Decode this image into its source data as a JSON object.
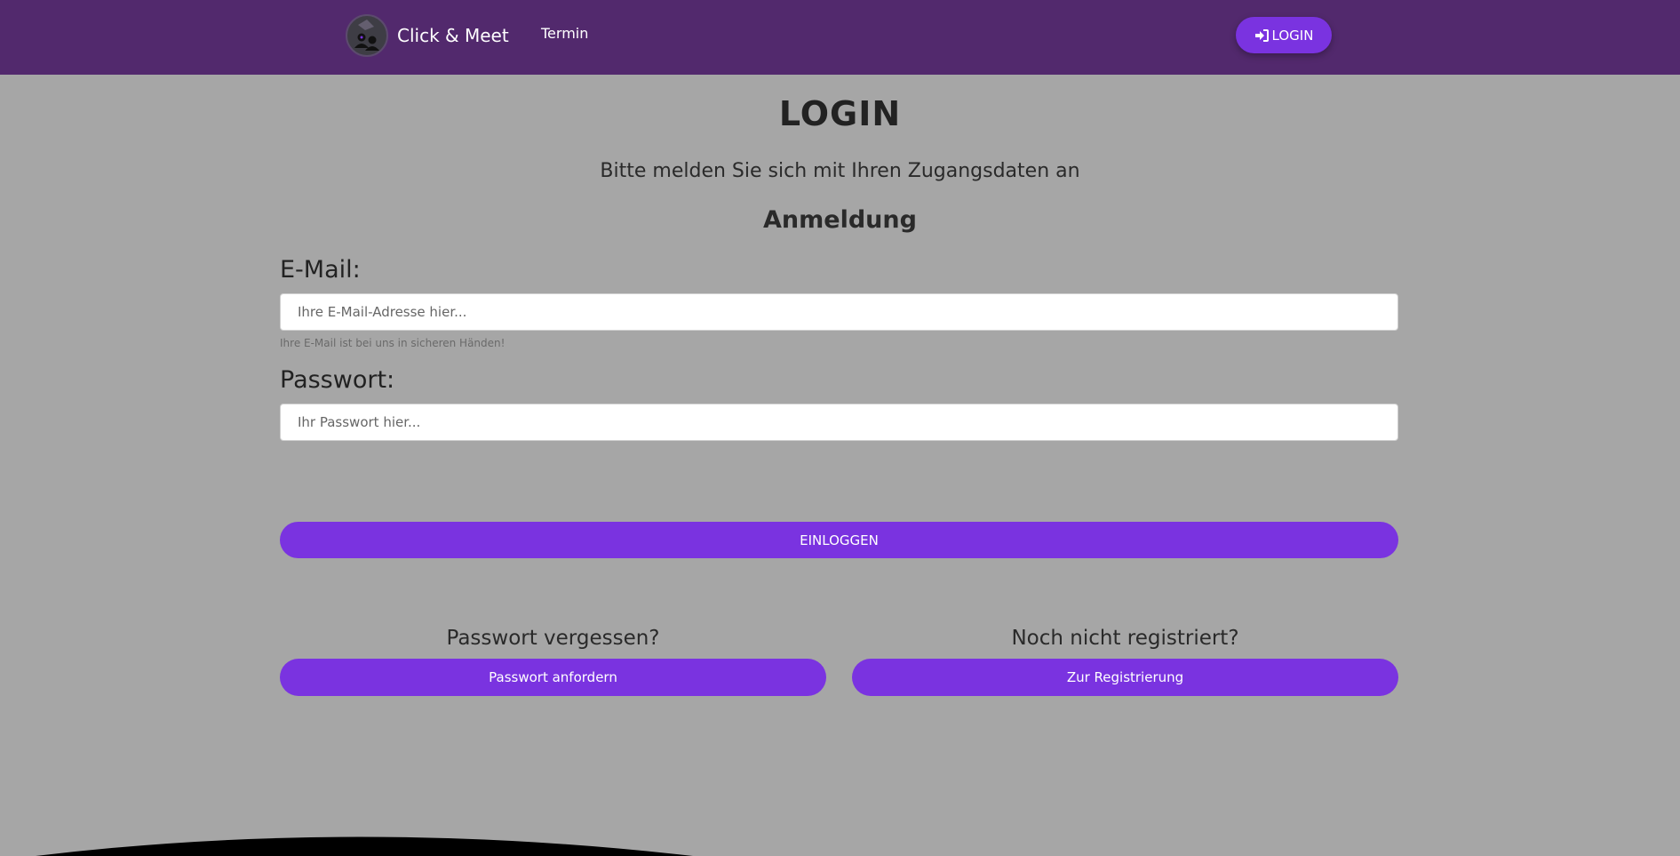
{
  "navbar": {
    "brand": "Click & Meet",
    "links": [
      {
        "label": "Termin"
      }
    ],
    "login_button": {
      "label": "LOGIN",
      "icon": "sign-in-icon"
    }
  },
  "main": {
    "title": "LOGIN",
    "subtitle": "Bitte melden Sie sich mit Ihren Zugangsdaten an",
    "section_heading": "Anmeldung",
    "email": {
      "label": "E-Mail:",
      "placeholder": "Ihre E-Mail-Adresse hier...",
      "value": "",
      "help": "Ihre E-Mail ist bei uns in sicheren Händen!"
    },
    "password": {
      "label": "Passwort:",
      "placeholder": "Ihr Passwort hier...",
      "value": ""
    },
    "submit_label": "EINLOGGEN",
    "forgot": {
      "heading": "Passwort vergessen?",
      "button": "Passwort anfordern"
    },
    "register": {
      "heading": "Noch nicht registriert?",
      "button": "Zur Registrierung"
    }
  },
  "colors": {
    "navbar": "#52296d",
    "accent": "#7a33e0",
    "background": "#a6a6a6"
  }
}
